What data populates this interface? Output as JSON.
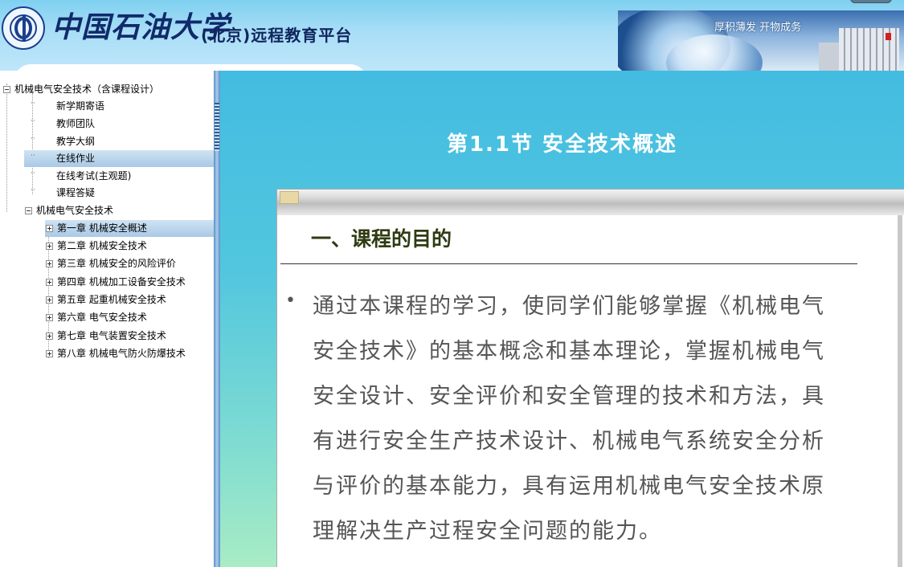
{
  "header": {
    "university_name": "中国石油大学",
    "platform_name": "(北京)远程教育平台",
    "banner_slogan": "厚积薄发 开物成务"
  },
  "sidebar": {
    "root": "机械电气安全技术（含课程设计）",
    "items": [
      "新学期寄语",
      "教师团队",
      "教学大纲",
      "在线作业",
      "在线考试(主观题)",
      "课程答疑"
    ],
    "course_node": "机械电气安全技术",
    "chapters": [
      "第一章 机械安全概述",
      "第二章 机械安全技术",
      "第三章 机械安全的风险评价",
      "第四章 机械加工设备安全技术",
      "第五章 起重机械安全技术",
      "第六章 电气安全技术",
      "第七章 电气装置安全技术",
      "第八章 机械电气防火防爆技术"
    ]
  },
  "content": {
    "section_title": "第1.1节 安全技术概述",
    "slide_heading": "一、课程的目的",
    "bullet_mark": "•",
    "slide_text_lines": [
      "通过本课程的学习，使同学们能够掌握《机械电气",
      "安全技术》的基本概念和基本理论，掌握机械电气",
      "安全设计、安全评价和安全管理的技术和方法，具",
      "有进行安全生产技术设计、机械电气系统安全分析",
      "与评价的基本能力，具有运用机械电气安全技术原",
      "理解决生产过程安全问题的能力。"
    ]
  }
}
